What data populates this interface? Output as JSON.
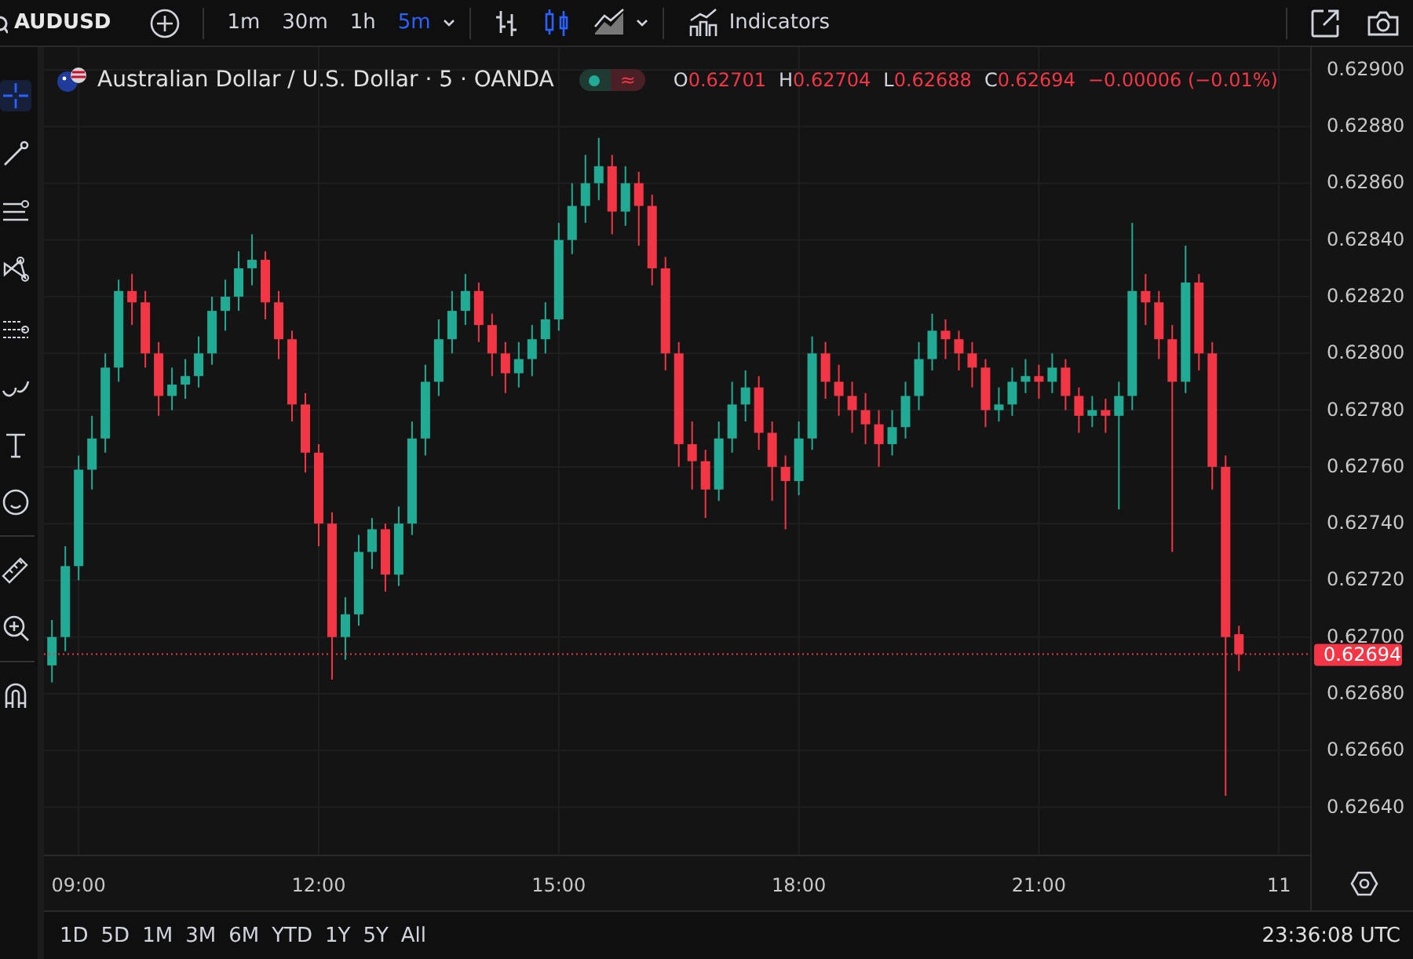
{
  "top_bar": {
    "symbol": "AUDUSD",
    "intervals": [
      {
        "label": "1m",
        "selected": false
      },
      {
        "label": "30m",
        "selected": false
      },
      {
        "label": "1h",
        "selected": false
      },
      {
        "label": "5m",
        "selected": true
      }
    ],
    "chart_types": [
      {
        "kind": "bars",
        "selected": false
      },
      {
        "kind": "candles",
        "selected": true
      },
      {
        "kind": "area",
        "selected": false
      }
    ],
    "indicators_label": "Indicators"
  },
  "tool_groups": [
    [
      {
        "kind": "crosshair",
        "selected": true
      },
      {
        "kind": "trendline",
        "selected": false
      },
      {
        "kind": "fib",
        "selected": false
      },
      {
        "kind": "pattern",
        "selected": false
      },
      {
        "kind": "projection",
        "selected": false
      },
      {
        "kind": "brush",
        "selected": false
      },
      {
        "kind": "text",
        "selected": false
      },
      {
        "kind": "emoji",
        "selected": false
      }
    ],
    [
      {
        "kind": "ruler",
        "selected": false
      },
      {
        "kind": "zoom",
        "selected": false
      }
    ],
    [
      {
        "kind": "magnet",
        "selected": false
      }
    ]
  ],
  "legend": {
    "title": "Australian Dollar / U.S. Dollar · 5 · OANDA",
    "status_symbol": "≈",
    "ohlc": [
      {
        "key": "O",
        "value": "0.62701"
      },
      {
        "key": "H",
        "value": "0.62704"
      },
      {
        "key": "L",
        "value": "0.62688"
      },
      {
        "key": "C",
        "value": "0.62694"
      }
    ],
    "change": "−0.00006 (−0.01%)"
  },
  "chart": {
    "chart_data": {
      "type": "candlestick",
      "grid": true,
      "x": [
        520,
        530,
        540,
        550,
        560,
        570,
        580,
        590,
        600,
        610,
        620,
        630,
        640,
        650,
        660,
        670,
        680,
        690,
        700,
        710,
        720,
        730,
        740,
        750,
        760,
        770,
        780,
        790,
        800,
        810,
        820,
        830,
        840,
        850,
        860,
        870,
        880,
        890,
        900,
        910,
        920,
        930,
        940,
        950,
        960,
        970,
        980,
        990,
        1000,
        1010,
        1020,
        1030,
        1040,
        1050,
        1060,
        1070,
        1080,
        1090,
        1100,
        1110,
        1120,
        1130,
        1140,
        1150,
        1160,
        1170,
        1180,
        1190,
        1200,
        1210,
        1220,
        1230,
        1240,
        1250,
        1260,
        1270,
        1280,
        1290,
        1300,
        1310,
        1320,
        1330,
        1340,
        1350,
        1360,
        1370,
        1380,
        1390,
        1400,
        1410
      ],
      "xlim": [
        514,
        1464
      ],
      "ylim": [
        0.62623,
        0.62908
      ],
      "xticks": [
        {
          "value": 540,
          "label": "09:00"
        },
        {
          "value": 720,
          "label": "12:00"
        },
        {
          "value": 900,
          "label": "15:00"
        },
        {
          "value": 1080,
          "label": "18:00"
        },
        {
          "value": 1260,
          "label": "21:00"
        }
      ],
      "yticks": [
        {
          "value": 0.629,
          "label": "0.62900"
        },
        {
          "value": 0.6288,
          "label": "0.62880"
        },
        {
          "value": 0.6286,
          "label": "0.62860"
        },
        {
          "value": 0.6284,
          "label": "0.62840"
        },
        {
          "value": 0.6282,
          "label": "0.62820"
        },
        {
          "value": 0.628,
          "label": "0.62800"
        },
        {
          "value": 0.6278,
          "label": "0.62780"
        },
        {
          "value": 0.6276,
          "label": "0.62760"
        },
        {
          "value": 0.6274,
          "label": "0.62740"
        },
        {
          "value": 0.6272,
          "label": "0.62720"
        },
        {
          "value": 0.627,
          "label": "0.62700"
        },
        {
          "value": 0.6268,
          "label": "0.62680"
        },
        {
          "value": 0.6266,
          "label": "0.62660"
        },
        {
          "value": 0.6264,
          "label": "0.62640"
        }
      ],
      "ohlc": [
        [
          0.6269,
          0.62706,
          0.62684,
          0.627
        ],
        [
          0.627,
          0.62732,
          0.62695,
          0.62725
        ],
        [
          0.62725,
          0.62764,
          0.6272,
          0.62759
        ],
        [
          0.62759,
          0.62778,
          0.62752,
          0.6277
        ],
        [
          0.6277,
          0.628,
          0.62765,
          0.62795
        ],
        [
          0.62795,
          0.62826,
          0.6279,
          0.62822
        ],
        [
          0.62822,
          0.62828,
          0.6281,
          0.62818
        ],
        [
          0.62818,
          0.62822,
          0.62795,
          0.628
        ],
        [
          0.628,
          0.62804,
          0.62778,
          0.62785
        ],
        [
          0.62785,
          0.62795,
          0.6278,
          0.62789
        ],
        [
          0.62789,
          0.62798,
          0.62784,
          0.62792
        ],
        [
          0.62792,
          0.62806,
          0.62788,
          0.628
        ],
        [
          0.628,
          0.6282,
          0.62796,
          0.62815
        ],
        [
          0.62815,
          0.62826,
          0.62808,
          0.6282
        ],
        [
          0.6282,
          0.62836,
          0.62815,
          0.6283
        ],
        [
          0.6283,
          0.62842,
          0.62824,
          0.62833
        ],
        [
          0.62833,
          0.62836,
          0.62812,
          0.62818
        ],
        [
          0.62818,
          0.62822,
          0.62798,
          0.62805
        ],
        [
          0.62805,
          0.62808,
          0.62776,
          0.62782
        ],
        [
          0.62782,
          0.62786,
          0.62758,
          0.62765
        ],
        [
          0.62765,
          0.62768,
          0.62732,
          0.6274
        ],
        [
          0.6274,
          0.62744,
          0.62685,
          0.627
        ],
        [
          0.627,
          0.62714,
          0.62692,
          0.62708
        ],
        [
          0.62708,
          0.62736,
          0.62704,
          0.6273
        ],
        [
          0.6273,
          0.62742,
          0.62724,
          0.62738
        ],
        [
          0.62738,
          0.6274,
          0.62716,
          0.62722
        ],
        [
          0.62722,
          0.62746,
          0.62718,
          0.6274
        ],
        [
          0.6274,
          0.62776,
          0.62736,
          0.6277
        ],
        [
          0.6277,
          0.62796,
          0.62764,
          0.6279
        ],
        [
          0.6279,
          0.62812,
          0.62785,
          0.62805
        ],
        [
          0.62805,
          0.62822,
          0.628,
          0.62815
        ],
        [
          0.62815,
          0.62828,
          0.6281,
          0.62822
        ],
        [
          0.62822,
          0.62825,
          0.62804,
          0.6281
        ],
        [
          0.6281,
          0.62814,
          0.62792,
          0.628
        ],
        [
          0.628,
          0.62804,
          0.62786,
          0.62793
        ],
        [
          0.62793,
          0.62804,
          0.62788,
          0.62798
        ],
        [
          0.62798,
          0.6281,
          0.62792,
          0.62805
        ],
        [
          0.62805,
          0.62818,
          0.628,
          0.62812
        ],
        [
          0.62812,
          0.62846,
          0.62808,
          0.6284
        ],
        [
          0.6284,
          0.6286,
          0.62835,
          0.62852
        ],
        [
          0.62852,
          0.6287,
          0.62846,
          0.6286
        ],
        [
          0.6286,
          0.62876,
          0.62854,
          0.62866
        ],
        [
          0.62866,
          0.6287,
          0.62842,
          0.6285
        ],
        [
          0.6285,
          0.62866,
          0.62845,
          0.6286
        ],
        [
          0.6286,
          0.62864,
          0.62838,
          0.62852
        ],
        [
          0.62852,
          0.62856,
          0.62824,
          0.6283
        ],
        [
          0.6283,
          0.62834,
          0.62794,
          0.628
        ],
        [
          0.628,
          0.62804,
          0.6276,
          0.62768
        ],
        [
          0.62768,
          0.62776,
          0.62752,
          0.62762
        ],
        [
          0.62762,
          0.62766,
          0.62742,
          0.62752
        ],
        [
          0.62752,
          0.62776,
          0.62748,
          0.6277
        ],
        [
          0.6277,
          0.6279,
          0.62765,
          0.62782
        ],
        [
          0.62782,
          0.62794,
          0.62776,
          0.62788
        ],
        [
          0.62788,
          0.62792,
          0.62766,
          0.62772
        ],
        [
          0.62772,
          0.62776,
          0.62748,
          0.6276
        ],
        [
          0.6276,
          0.62764,
          0.62738,
          0.62755
        ],
        [
          0.62755,
          0.62776,
          0.6275,
          0.6277
        ],
        [
          0.6277,
          0.62806,
          0.62766,
          0.628
        ],
        [
          0.628,
          0.62804,
          0.62784,
          0.6279
        ],
        [
          0.6279,
          0.62796,
          0.62778,
          0.62785
        ],
        [
          0.62785,
          0.6279,
          0.62772,
          0.6278
        ],
        [
          0.6278,
          0.62786,
          0.62768,
          0.62775
        ],
        [
          0.62775,
          0.6278,
          0.6276,
          0.62768
        ],
        [
          0.62768,
          0.6278,
          0.62764,
          0.62774
        ],
        [
          0.62774,
          0.6279,
          0.6277,
          0.62785
        ],
        [
          0.62785,
          0.62804,
          0.6278,
          0.62798
        ],
        [
          0.62798,
          0.62814,
          0.62794,
          0.62808
        ],
        [
          0.62808,
          0.62812,
          0.62798,
          0.62805
        ],
        [
          0.62805,
          0.62808,
          0.62794,
          0.628
        ],
        [
          0.628,
          0.62804,
          0.62788,
          0.62795
        ],
        [
          0.62795,
          0.62798,
          0.62774,
          0.6278
        ],
        [
          0.6278,
          0.62788,
          0.62776,
          0.62782
        ],
        [
          0.62782,
          0.62795,
          0.62778,
          0.6279
        ],
        [
          0.6279,
          0.62798,
          0.62786,
          0.62792
        ],
        [
          0.62792,
          0.62796,
          0.62784,
          0.6279
        ],
        [
          0.6279,
          0.628,
          0.62786,
          0.62795
        ],
        [
          0.62795,
          0.62798,
          0.6278,
          0.62785
        ],
        [
          0.62785,
          0.62788,
          0.62772,
          0.62778
        ],
        [
          0.62778,
          0.62785,
          0.62774,
          0.6278
        ],
        [
          0.6278,
          0.62784,
          0.62772,
          0.62778
        ],
        [
          0.62778,
          0.6279,
          0.62745,
          0.62785
        ],
        [
          0.62785,
          0.62846,
          0.6278,
          0.62822
        ],
        [
          0.62822,
          0.62828,
          0.6281,
          0.62818
        ],
        [
          0.62818,
          0.62822,
          0.62798,
          0.62805
        ],
        [
          0.62805,
          0.6281,
          0.6273,
          0.6279
        ],
        [
          0.6279,
          0.62838,
          0.62786,
          0.62825
        ],
        [
          0.62825,
          0.62828,
          0.62794,
          0.628
        ],
        [
          0.628,
          0.62804,
          0.62752,
          0.6276
        ],
        [
          0.6276,
          0.62764,
          0.62644,
          0.627
        ],
        [
          0.62701,
          0.62704,
          0.62688,
          0.62694
        ]
      ],
      "ref_lines": [
        {
          "axis": "y",
          "value": 0.62694,
          "label": "0.62694",
          "color": "#f23645"
        }
      ]
    },
    "day_label": "11"
  },
  "bottom_bar": {
    "ranges": [
      "1D",
      "5D",
      "1M",
      "3M",
      "6M",
      "YTD",
      "1Y",
      "5Y",
      "All"
    ],
    "clock": "23:36:08 UTC"
  }
}
